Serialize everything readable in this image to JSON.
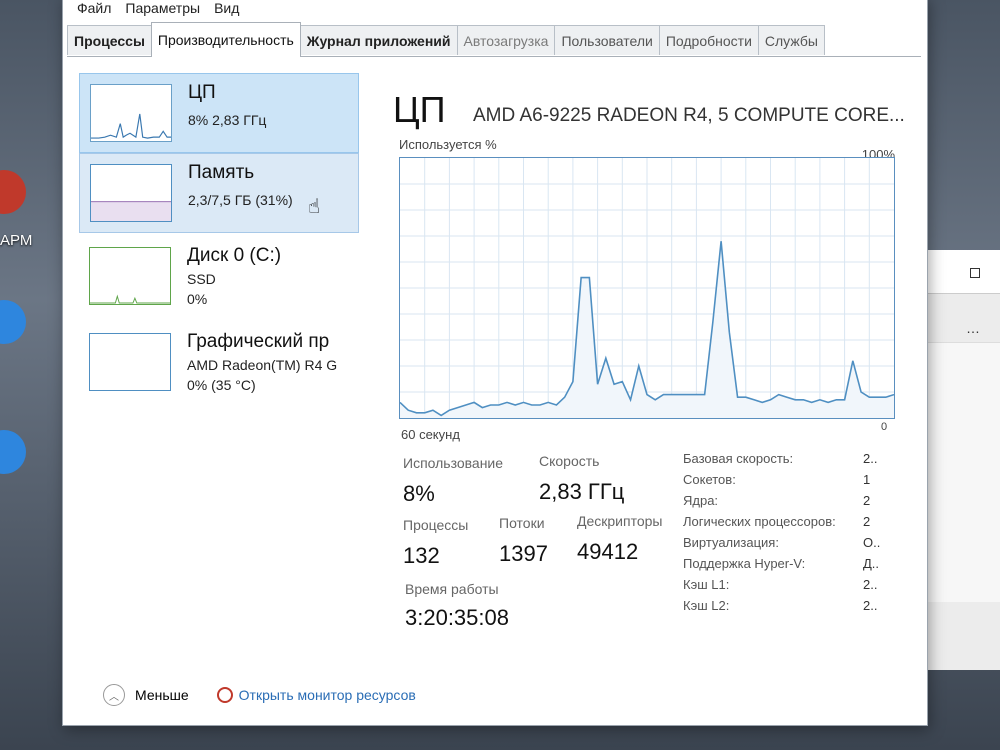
{
  "desktop": {
    "apm_label": "АРМ"
  },
  "menu": [
    "Файл",
    "Параметры",
    "Вид"
  ],
  "tabs": [
    {
      "label": "Процессы",
      "state": "bold"
    },
    {
      "label": "Производительность",
      "state": "active"
    },
    {
      "label": "Журнал приложений",
      "state": "bold"
    },
    {
      "label": "Автозагрузка",
      "state": "dim"
    },
    {
      "label": "Пользователи",
      "state": "normal"
    },
    {
      "label": "Подробности",
      "state": "normal"
    },
    {
      "label": "Службы",
      "state": "normal"
    }
  ],
  "sidebar": {
    "cpu": {
      "title": "ЦП",
      "line1": "8%  2,83 ГГц"
    },
    "memory": {
      "title": "Память",
      "line1": "2,3/7,5 ГБ (31%)"
    },
    "disk": {
      "title": "Диск 0 (C:)",
      "line1": "SSD",
      "line2": "0%"
    },
    "gpu": {
      "title": "Графический пр",
      "line1": "AMD Radeon(TM) R4 G",
      "line2": "0%  (35 °C)"
    }
  },
  "main": {
    "title": "ЦП",
    "model": "AMD A6-9225 RADEON R4, 5 COMPUTE CORE...",
    "graph_top_left": "Используется %",
    "graph_top_right": "100%",
    "graph_bottom_left": "60 секунд",
    "graph_bottom_right": "0",
    "usage_label": "Использование",
    "usage_value": "8%",
    "speed_label": "Скорость",
    "speed_value": "2,83 ГГц",
    "processes_label": "Процессы",
    "processes_value": "132",
    "threads_label": "Потоки",
    "threads_value": "1397",
    "handles_label": "Дескрипторы",
    "handles_value": "49412",
    "uptime_label": "Время работы",
    "uptime_value": "3:20:35:08",
    "specs": [
      {
        "k": "Базовая скорость:",
        "v": "2.."
      },
      {
        "k": "Сокетов:",
        "v": "1"
      },
      {
        "k": "Ядра:",
        "v": "2"
      },
      {
        "k": "Логических процессоров:",
        "v": "2"
      },
      {
        "k": "Виртуализация:",
        "v": "О.."
      },
      {
        "k": "Поддержка Hyper-V:",
        "v": "Д.."
      },
      {
        "k": "Кэш L1:",
        "v": "2.."
      },
      {
        "k": "Кэш L2:",
        "v": "2.."
      }
    ]
  },
  "cpu_usage_history": [
    6,
    3,
    2,
    2,
    3,
    1,
    3,
    4,
    5,
    6,
    4,
    5,
    5,
    6,
    5,
    6,
    5,
    5,
    6,
    5,
    8,
    14,
    54,
    54,
    13,
    23,
    13,
    14,
    7,
    20,
    9,
    7,
    9,
    9,
    9,
    9,
    9,
    9,
    37,
    68,
    33,
    8,
    8,
    7,
    6,
    7,
    9,
    8,
    7,
    7,
    6,
    7,
    6,
    7,
    7,
    22,
    10,
    8,
    8,
    8,
    9
  ],
  "footer": {
    "less": "Меньше",
    "monitor": "Открыть монитор ресурсов"
  },
  "colors": {
    "accent": "#4f8fc2",
    "disk_green": "#5fa54a",
    "selected_bg": "#cce4f7"
  }
}
